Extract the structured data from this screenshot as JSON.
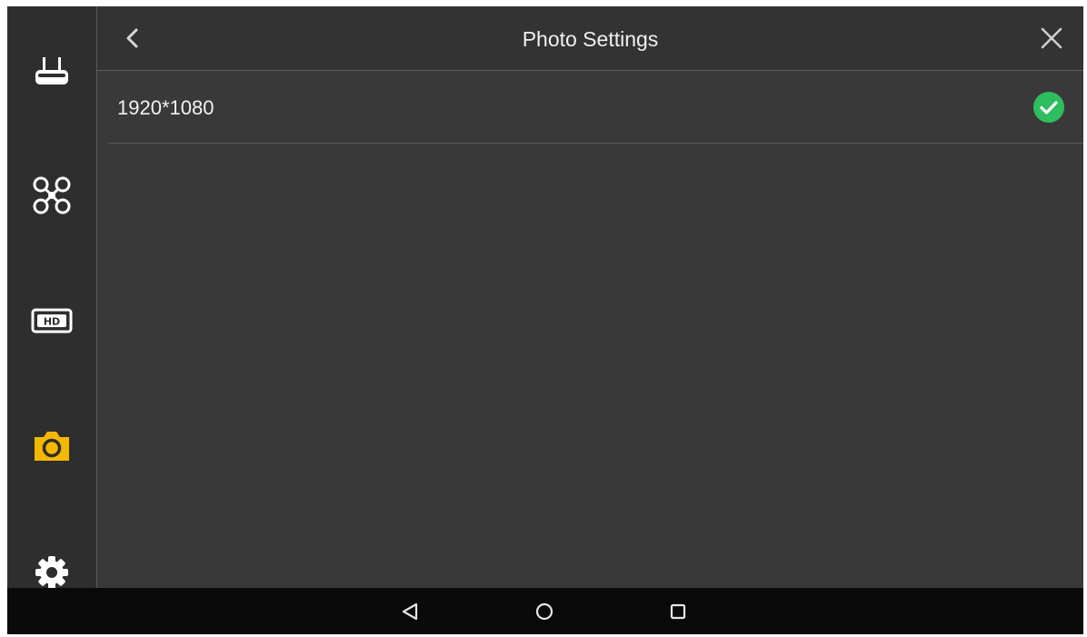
{
  "header": {
    "title": "Photo Settings"
  },
  "options": [
    {
      "label": "1920*1080",
      "selected": true
    }
  ],
  "sidebar": {
    "items": [
      {
        "icon": "remote-controller-icon",
        "active": false
      },
      {
        "icon": "drone-icon",
        "active": false
      },
      {
        "icon": "hd-icon",
        "active": false,
        "text": "HD"
      },
      {
        "icon": "camera-icon",
        "active": true
      },
      {
        "icon": "gear-icon",
        "active": false
      }
    ]
  },
  "navbar": {
    "items": [
      "back-triangle-icon",
      "home-circle-icon",
      "recents-square-icon"
    ]
  },
  "colors": {
    "accent": "#f5b800",
    "check": "#2fbe5f",
    "icon": "#ffffff",
    "background": "#393939"
  }
}
